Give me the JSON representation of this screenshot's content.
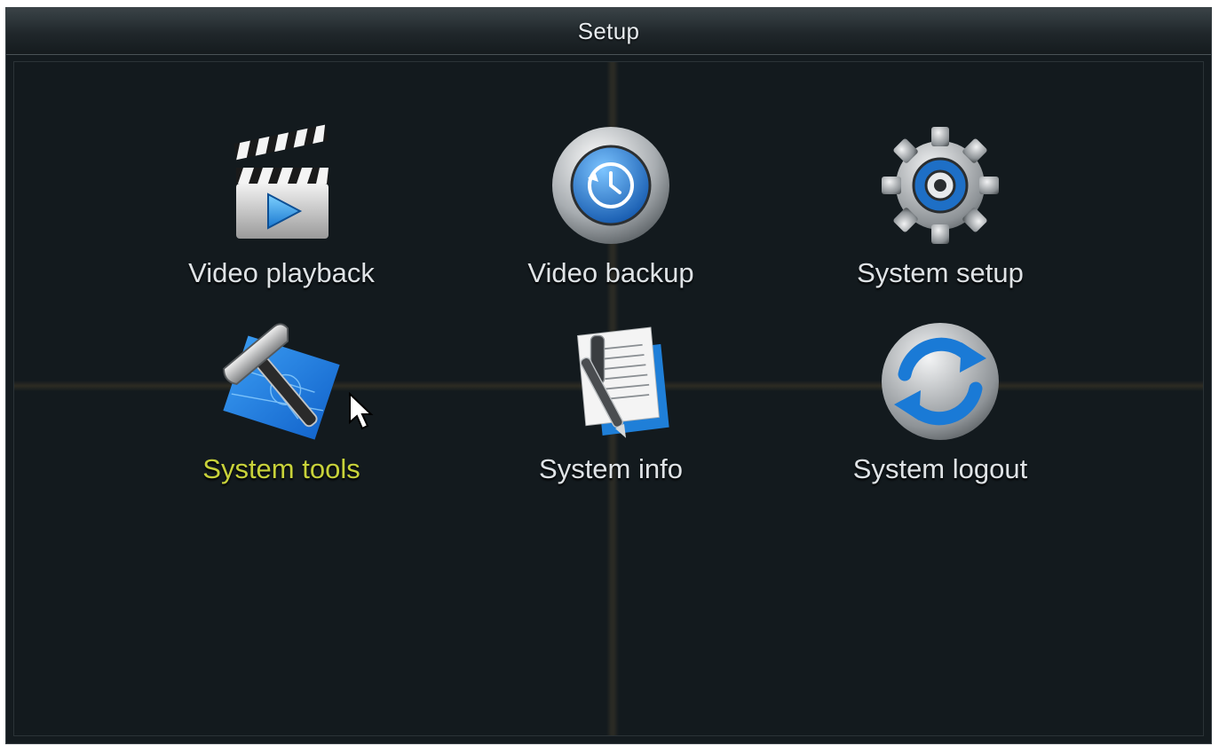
{
  "window": {
    "title": "Setup"
  },
  "menu": [
    {
      "label": "Video playback",
      "icon": "clapperboard-icon",
      "active": false
    },
    {
      "label": "Video backup",
      "icon": "backup-clock-icon",
      "active": false
    },
    {
      "label": "System setup",
      "icon": "gear-icon",
      "active": false
    },
    {
      "label": "System tools",
      "icon": "hammer-blueprint-icon",
      "active": true
    },
    {
      "label": "System info",
      "icon": "document-pen-icon",
      "active": false
    },
    {
      "label": "System logout",
      "icon": "refresh-arrows-icon",
      "active": false
    }
  ],
  "colors": {
    "background": "#141b1f",
    "label": "#dfe3e6",
    "active_label": "#c8d23a",
    "accent_blue": "#1f7fd8"
  }
}
